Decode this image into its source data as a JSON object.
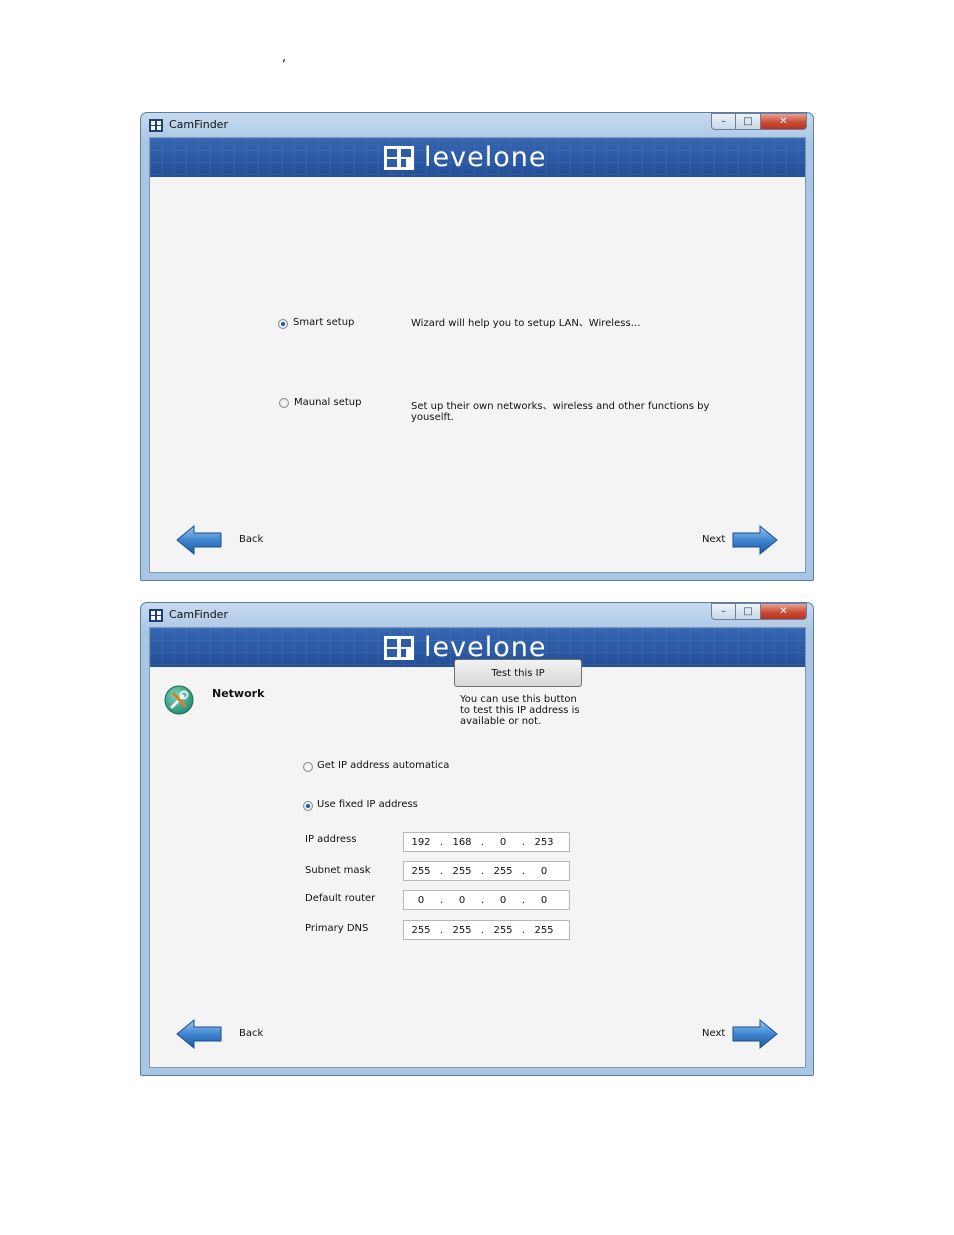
{
  "page": {
    "stray_mark": ","
  },
  "window1": {
    "title": "CamFinder",
    "logo_text": "levelone",
    "options": [
      {
        "label": "Smart setup",
        "selected": true,
        "description": "Wizard will help you to setup LAN、Wireless…"
      },
      {
        "label": "Maunal setup",
        "selected": false,
        "description": "Set up their own networks、wireless and other functions by youselft."
      }
    ],
    "back_label": "Back",
    "next_label": "Next"
  },
  "window2": {
    "title": "CamFinder",
    "logo_text": "levelone",
    "section_title": "Network",
    "section_icon": "tools-icon",
    "options": [
      {
        "label": "Get IP address automatica",
        "selected": false
      },
      {
        "label": "Use fixed IP address",
        "selected": true
      }
    ],
    "fields": [
      {
        "label": "IP address",
        "octets": [
          "192",
          "168",
          "0",
          "253"
        ]
      },
      {
        "label": "Subnet mask",
        "octets": [
          "255",
          "255",
          "255",
          "0"
        ]
      },
      {
        "label": "Default router",
        "octets": [
          "0",
          "0",
          "0",
          "0"
        ]
      },
      {
        "label": "Primary DNS",
        "octets": [
          "255",
          "255",
          "255",
          "255"
        ]
      }
    ],
    "test_button": "Test this IP",
    "test_note": "You can use this button to test this IP address is available or not.",
    "back_label": "Back",
    "next_label": "Next"
  },
  "colors": {
    "banner": "#2d5da8",
    "frame": "#a9c6e5",
    "close": "#c94c35",
    "arrow": "#3f86d0"
  }
}
